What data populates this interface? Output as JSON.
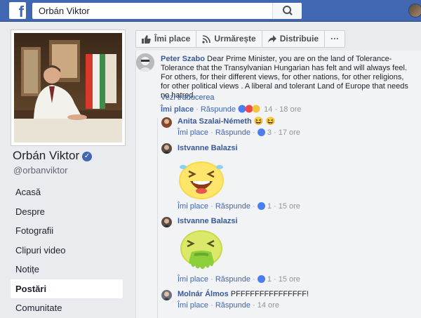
{
  "topbar": {
    "logo": "f",
    "search_value": "Orbán Viktor"
  },
  "page": {
    "name": "Orbán Viktor",
    "handle": "@orbanviktor"
  },
  "nav": {
    "items": [
      {
        "label": "Acasă"
      },
      {
        "label": "Despre"
      },
      {
        "label": "Fotografii"
      },
      {
        "label": "Clipuri video"
      },
      {
        "label": "Notițe"
      },
      {
        "label": "Postări"
      },
      {
        "label": "Comunitate"
      }
    ]
  },
  "actions": {
    "like": "Îmi place",
    "follow": "Urmărește",
    "share": "Distribuie",
    "more": "···"
  },
  "comments": {
    "c1": {
      "author": "Peter Szabo",
      "text": "Dear Prime Minister, you are on the land of Tolerance- Tolerance that the Transylvanian Hungarian has felt and will always feel. For others, for their different views, for other nations, for other religions, for other political views . A liberal and tolerant Land of Europe that needs no hatred.",
      "translate": "Vezi traducerea",
      "like": "Îmi place",
      "reply": "Răspunde",
      "reactions": "14",
      "time": "18 ore"
    },
    "c2": {
      "author": "Anita Szalai-Németh",
      "emoji": "😆 😆",
      "like": "Îmi place",
      "reply": "Răspunde",
      "reactions": "3",
      "time": "17 ore"
    },
    "c3": {
      "author": "Istvanne Balazsi",
      "like": "Îmi place",
      "reply": "Răspunde",
      "reactions": "1",
      "time": "15 ore"
    },
    "c4": {
      "author": "Istvanne Balazsi",
      "like": "Îmi place",
      "reply": "Răspunde",
      "reactions": "1",
      "time": "15 ore"
    },
    "c5": {
      "author": "Molnár Álmos",
      "text": "PFFFFFFFFFFFFFFF!",
      "like": "Îmi place",
      "reply": "Răspunde",
      "time": "14 ore"
    }
  },
  "colors": {
    "brand": "#4267b2",
    "link": "#385898",
    "muted": "#90949c"
  }
}
